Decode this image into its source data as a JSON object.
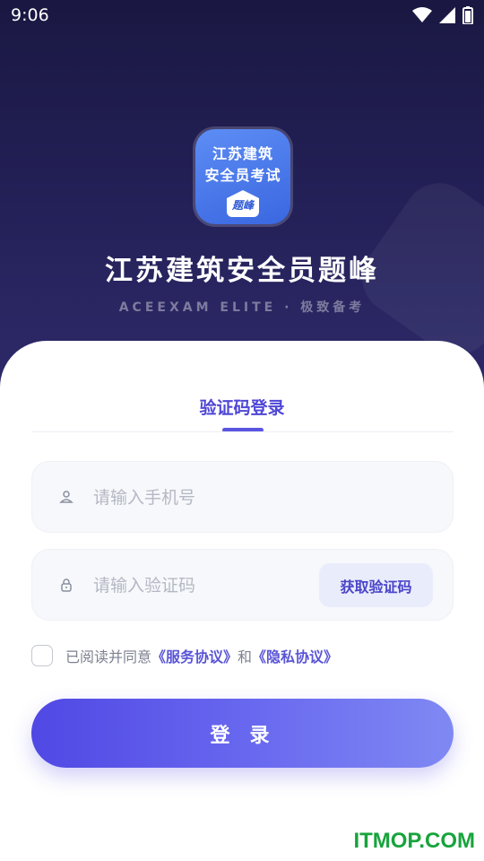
{
  "status_bar": {
    "time": "9:06"
  },
  "app": {
    "icon_line1": "江苏建筑",
    "icon_line2": "安全员考试",
    "icon_badge": "题峰",
    "title": "江苏建筑安全员题峰",
    "subtitle": "ACEEXAM ELITE · 极致备考"
  },
  "login": {
    "tab_label": "验证码登录",
    "phone": {
      "placeholder": "请输入手机号",
      "value": ""
    },
    "code": {
      "placeholder": "请输入验证码",
      "value": ""
    },
    "get_code_label": "获取验证码",
    "agreement": {
      "prefix": "已阅读并同意",
      "service_link": "《服务协议》",
      "joiner": "和",
      "privacy_link": "《隐私协议》",
      "checked": false
    },
    "submit_label": "登录"
  },
  "watermark": "ITMOP.COM",
  "colors": {
    "hero_bg": "#1e1c4b",
    "accent": "#5a55e0",
    "button_gradient_start": "#5048e4",
    "button_gradient_end": "#7f89f2",
    "watermark": "#17a43c"
  }
}
